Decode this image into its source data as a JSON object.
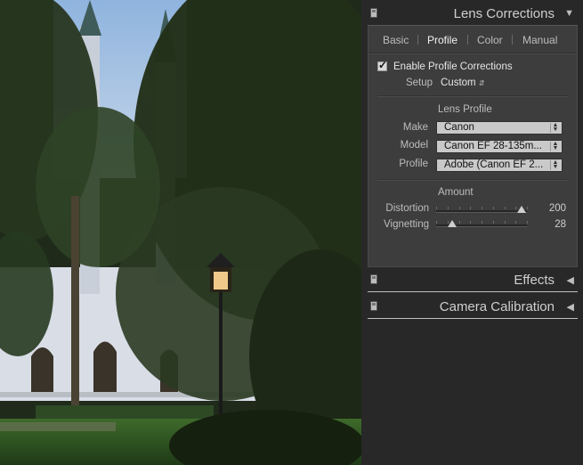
{
  "lens_corrections": {
    "title": "Lens Corrections",
    "tabs": [
      "Basic",
      "Profile",
      "Color",
      "Manual"
    ],
    "active_tab": "Profile",
    "enable_label": "Enable Profile Corrections",
    "enable_checked": true,
    "setup": {
      "label": "Setup",
      "value": "Custom"
    },
    "lens_profile": {
      "heading": "Lens Profile",
      "make": {
        "label": "Make",
        "value": "Canon"
      },
      "model": {
        "label": "Model",
        "value": "Canon EF 28-135m..."
      },
      "profile": {
        "label": "Profile",
        "value": "Adobe (Canon EF 2..."
      }
    },
    "amount": {
      "heading": "Amount",
      "distortion": {
        "label": "Distortion",
        "value": "200",
        "fraction": 0.94
      },
      "vignetting": {
        "label": "Vignetting",
        "value": "28",
        "fraction": 0.18
      }
    }
  },
  "effects": {
    "title": "Effects"
  },
  "camera_calibration": {
    "title": "Camera Calibration"
  },
  "colors": {
    "panel": "#3d3d3d",
    "background": "#282828",
    "dropdown": "#c9c9c9"
  }
}
